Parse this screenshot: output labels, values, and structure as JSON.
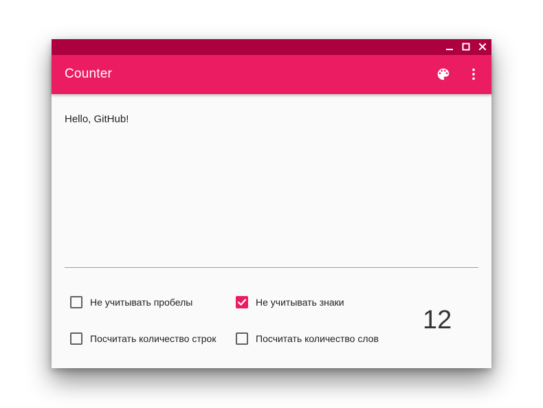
{
  "window": {
    "title_bar_color": "#ad003f"
  },
  "appbar": {
    "title": "Counter",
    "color": "#eb1c62",
    "palette_icon": "palette-icon",
    "more_icon": "more-vert-icon"
  },
  "editor": {
    "text": "Hello, GitHub!"
  },
  "options": [
    {
      "label": "Не учитывать пробелы",
      "checked": false
    },
    {
      "label": "Не учитывать знаки",
      "checked": true
    },
    {
      "label": "Посчитать количество строк",
      "checked": false
    },
    {
      "label": "Посчитать количество слов",
      "checked": false
    }
  ],
  "result": {
    "count": "12"
  }
}
